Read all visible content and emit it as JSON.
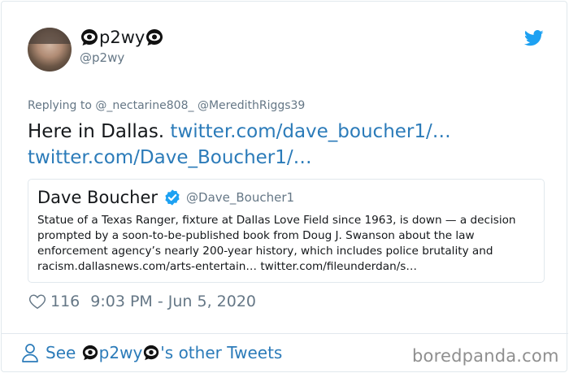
{
  "author": {
    "display_name": "p2wy",
    "name_emoji": "eye-in-speech-bubble",
    "handle": "@p2wy"
  },
  "reply": {
    "prefix": "Replying to",
    "recipients": "@_nectarine808_ @MeredithRiggs39"
  },
  "tweet": {
    "text": "Here in Dallas.",
    "link1": "twitter.com/dave_boucher1/…",
    "link2": "twitter.com/Dave_Boucher1/…"
  },
  "quote": {
    "name": "Dave Boucher",
    "handle": "@Dave_Boucher1",
    "text": "Statue of a Texas Ranger, fixture at Dallas Love Field since 1963, is down — a decision prompted by a soon-to-be-published book from Doug J. Swanson about the law enforcement agency’s nearly 200-year history, which includes police brutality and racism.dallasnews.com/arts-entertain… twitter.com/fileunderdan/s…"
  },
  "meta": {
    "likes": "116",
    "timestamp": "9:03 PM - Jun 5, 2020"
  },
  "footer": {
    "see_prefix": "See",
    "name": "p2wy",
    "suffix": "'s other Tweets"
  },
  "watermark": "boredpanda.com",
  "colors": {
    "link": "#2b7bb9",
    "secondary": "#657786",
    "twitter_blue": "#1da1f2",
    "border": "#e1e8ed"
  }
}
